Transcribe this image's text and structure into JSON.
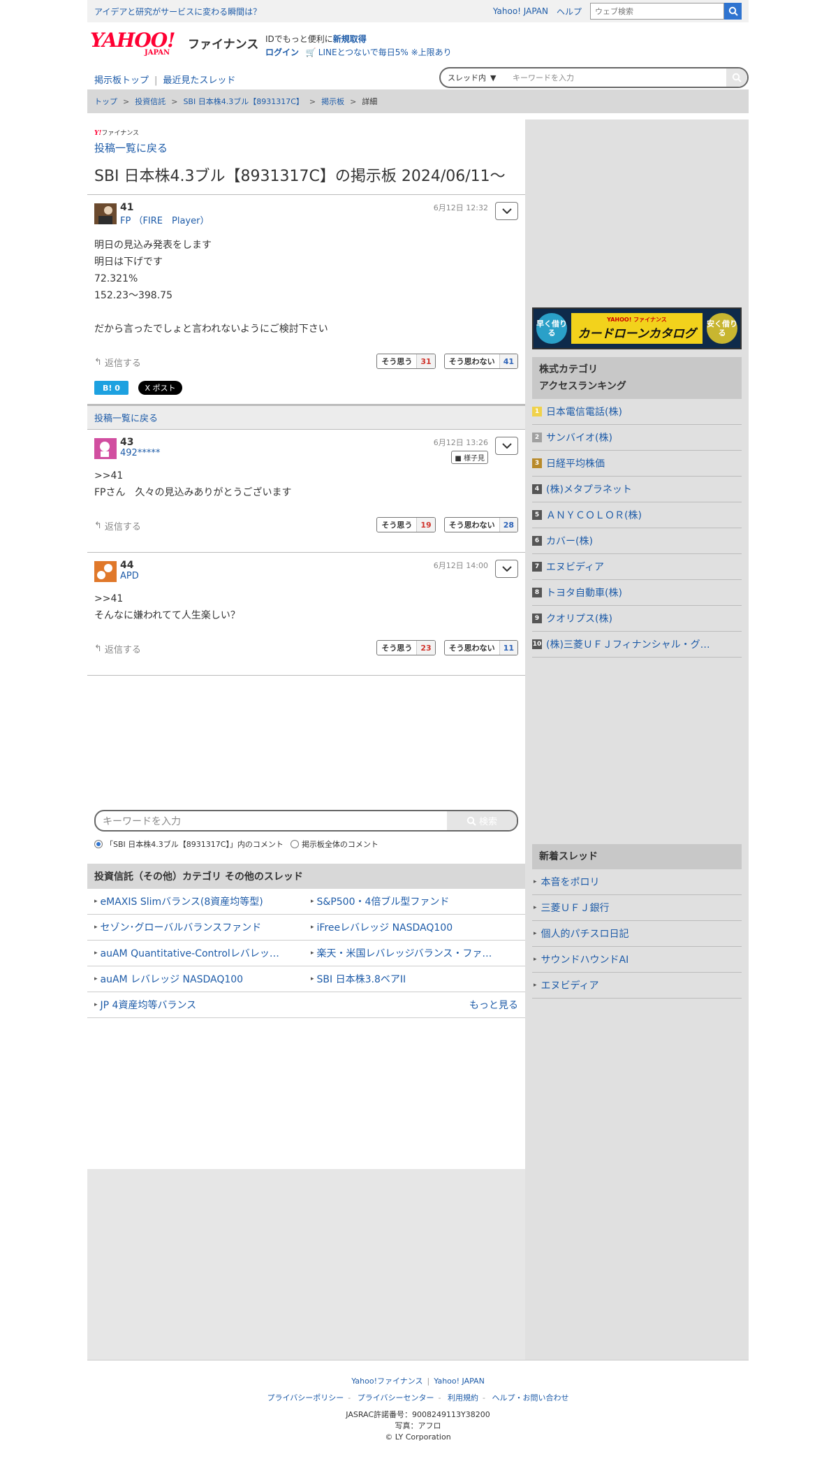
{
  "topbar": {
    "promo": "アイデアと研究がサービスに変わる瞬間は？",
    "yahoo_japan": "Yahoo! JAPAN",
    "help": "ヘルプ",
    "web_search_placeholder": "ウェブ検索"
  },
  "header": {
    "logo_text": "YAHOO!",
    "logo_japan": "JAPAN",
    "logo_sub": "ファイナンス",
    "id_prefix": "IDでもっと便利に",
    "register": "新規取得",
    "login": "ログイン",
    "line_promo": "LINEとつないで毎日5% ※上限あり"
  },
  "nav": {
    "board_top": "掲示板トップ",
    "recent_threads": "最近見たスレッド",
    "search_scope": "スレッド内",
    "search_placeholder": "キーワードを入力"
  },
  "breadcrumb": [
    "トップ",
    "投資信託",
    "SBI 日本株4.3ブル【8931317C】",
    "掲示板",
    "詳細"
  ],
  "board": {
    "mini_logo_y": "Y!",
    "mini_logo_text": "ファイナンス",
    "back_link": "投稿一覧に戻る",
    "title": "SBI 日本株4.3ブル【8931317C】の掲示板 2024/06/11〜"
  },
  "posts": [
    {
      "num": "41",
      "author": "FP （FIRE　Player）",
      "date": "6月12日 12:32",
      "body": [
        "明日の見込み発表をします",
        "明日は下げです",
        "72.321%",
        "152.23〜398.75",
        "",
        "だから言ったでしょと言われないようにご検討下さい"
      ],
      "reply": "返信する",
      "agree_label": "そう思う",
      "agree": "31",
      "disagree_label": "そう思わない",
      "disagree": "41"
    },
    {
      "num": "43",
      "author": "492*****",
      "date": "6月12日 13:26",
      "badge": "様子見",
      "body": [
        ">>41",
        "FPさん　久々の見込みありがとうございます"
      ],
      "reply": "返信する",
      "agree_label": "そう思う",
      "agree": "19",
      "disagree_label": "そう思わない",
      "disagree": "28"
    },
    {
      "num": "44",
      "author": "APD",
      "date": "6月12日 14:00",
      "body": [
        ">>41",
        "そんなに嫌われてて人生楽しい？"
      ],
      "reply": "返信する",
      "agree_label": "そう思う",
      "agree": "23",
      "disagree_label": "そう思わない",
      "disagree": "11"
    }
  ],
  "share": {
    "hatena": "B! 0",
    "tweet": "X ポスト"
  },
  "bottom_search": {
    "placeholder": "キーワードを入力",
    "button": "検索",
    "radio_thread": "「SBI 日本株4.3ブル【8931317C】」内のコメント",
    "radio_all": "掲示板全体のコメント"
  },
  "category": {
    "heading": "投資信託（その他）カテゴリ その他のスレッド",
    "items": [
      "eMAXIS Slimバランス(8資産均等型)",
      "S&P500・4倍ブル型ファンド",
      "セゾン･グローバルバランスファンド",
      "iFreeレバレッジ NASDAQ100",
      "auAM Quantitative-Controlレバレッ…",
      "楽天・米国レバレッジバランス・ファ…",
      "auAM レバレッジ NASDAQ100",
      "SBI 日本株3.8ベアII",
      "JP 4資産均等バランス"
    ],
    "more": "もっと見る"
  },
  "sidebar": {
    "banner": {
      "left": "早く借りる",
      "brand": "YAHOO! ファイナンス",
      "title": "カードローンカタログ",
      "right": "安く借りる"
    },
    "ranking_heading_1": "株式カテゴリ",
    "ranking_heading_2": "アクセスランキング",
    "ranking": [
      "日本電信電話(株)",
      "サンバイオ(株)",
      "日経平均株価",
      "(株)メタプラネット",
      "ＡＮＹＣＯＬＯＲ(株)",
      "カバー(株)",
      "エヌビディア",
      "トヨタ自動車(株)",
      "クオリプス(株)",
      "(株)三菱ＵＦＪフィナンシャル・グ…"
    ],
    "new_threads_heading": "新着スレッド",
    "new_threads": [
      "本音をポロリ",
      "三菱ＵＦＪ銀行",
      "個人的パチスロ日記",
      "サウンドハウンドAI",
      "エヌビディア"
    ]
  },
  "footer": {
    "links1": [
      "Yahoo!ファイナンス",
      "Yahoo! JAPAN"
    ],
    "links2": [
      "プライバシーポリシー",
      "プライバシーセンター",
      "利用規約",
      "ヘルプ・お問い合わせ"
    ],
    "jasrac": "JASRAC許諾番号：9008249113Y38200",
    "photo": "写真：アフロ",
    "copyright": "© LY Corporation"
  },
  "colors": {
    "link": "#1d5ba8",
    "agree": "#d0342c",
    "disagree": "#2d63b8",
    "brand_red": "#ff0033"
  }
}
